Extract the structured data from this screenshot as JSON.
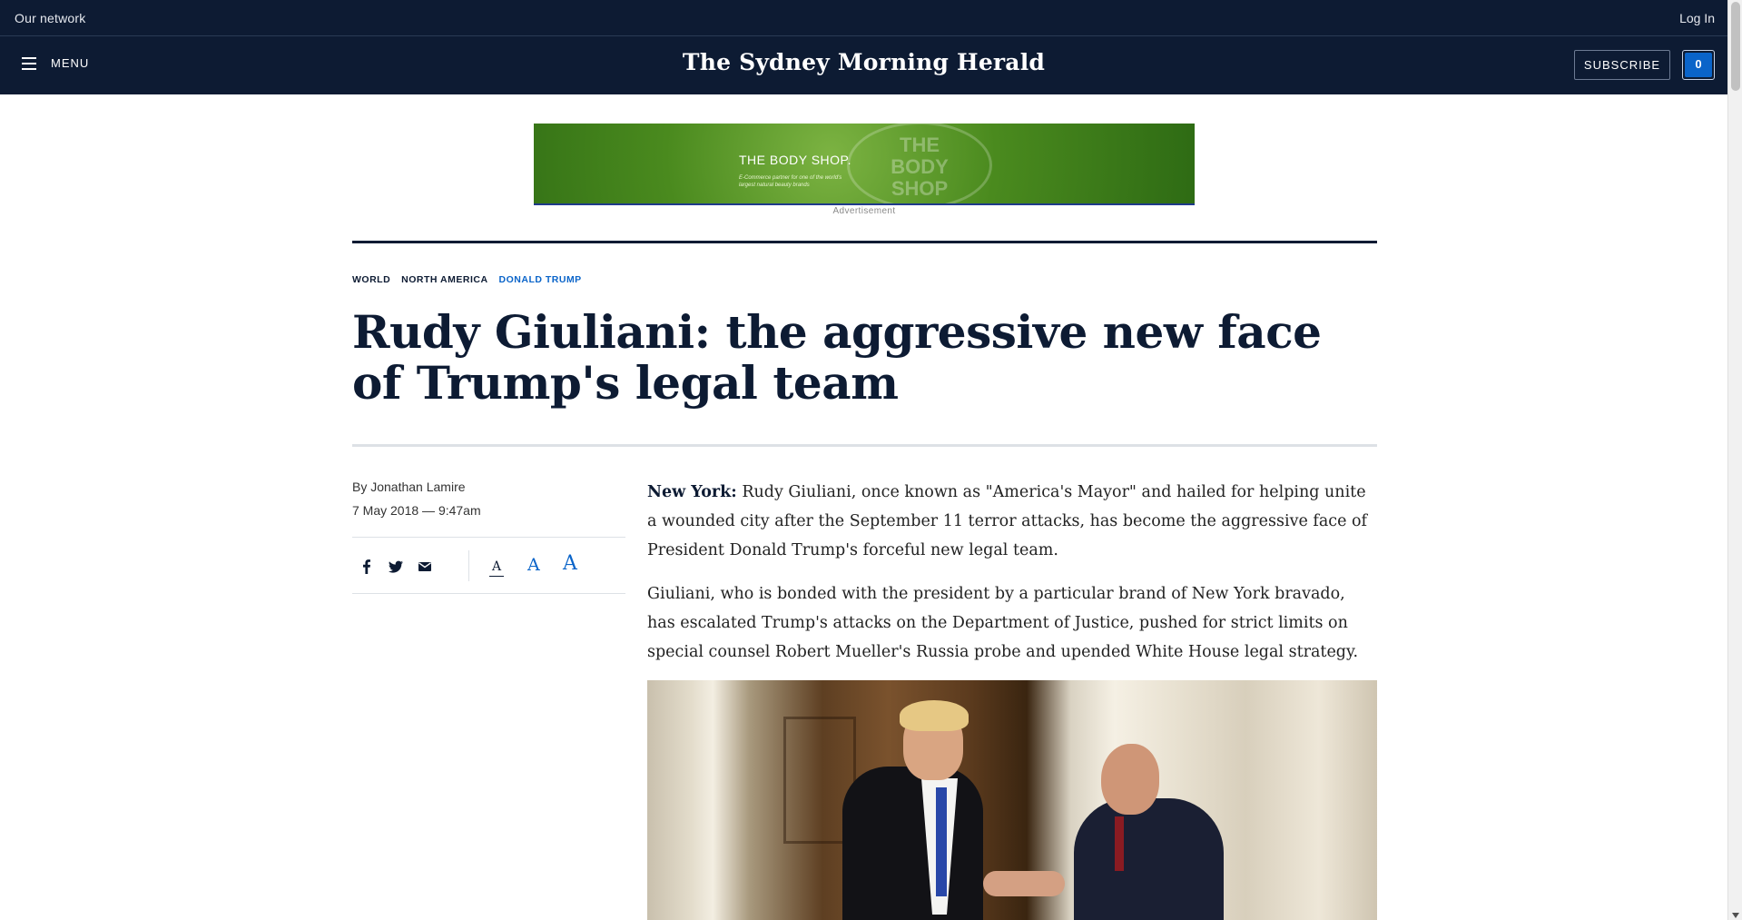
{
  "network_bar": {
    "left_label": "Our network",
    "login_label": "Log In"
  },
  "header": {
    "menu_label": "MENU",
    "masthead": "The Sydney Morning Herald",
    "subscribe_label": "SUBSCRIBE",
    "account_count": "0"
  },
  "ad": {
    "brand": "THE BODY SHOP.",
    "logo_text": "THE BODY SHOP",
    "tagline": "E-Commerce partner for one of the world's largest natural beauty brands",
    "label": "Advertisement"
  },
  "article": {
    "breadcrumbs": [
      "WORLD",
      "NORTH AMERICA",
      "DONALD TRUMP"
    ],
    "headline": "Rudy Giuliani: the aggressive new face of Trump's legal team",
    "byline": "By Jonathan Lamire",
    "date": "7 May 2018 — 9:47am",
    "font_size_glyph": "A",
    "paragraphs": [
      {
        "lead": "New York:",
        "text": " Rudy Giuliani, once known as \"America's Mayor\" and hailed for helping unite a wounded city after the September 11 terror attacks, has become the aggressive face of President Donald Trump's forceful new legal team."
      },
      {
        "lead": "",
        "text": "Giuliani, who is bonded with the president by a particular brand of New York bravado, has escalated Trump's attacks on the Department of Justice, pushed for strict limits on special counsel Robert Mueller's Russia probe and upended White House legal strategy."
      }
    ]
  },
  "icons": {
    "facebook": "facebook-icon",
    "twitter": "twitter-icon",
    "email": "email-icon",
    "menu": "hamburger-icon"
  },
  "colors": {
    "navy": "#0d1b33",
    "accent_blue": "#0a64c9",
    "rule_light": "#dde1e6"
  }
}
